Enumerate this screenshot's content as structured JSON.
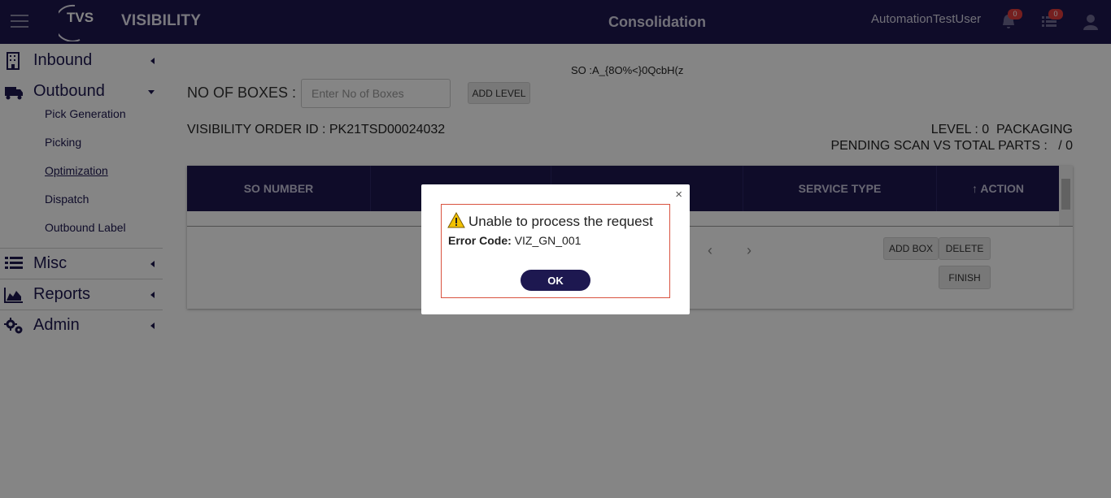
{
  "header": {
    "brand": "VISIBILITY",
    "logo_text": "TVS",
    "logo_subtext": "Supply Chain Solutions",
    "page_title": "Consolidation",
    "username": "AutomationTestUser",
    "notifications_count": "0",
    "tasks_count": "0"
  },
  "sidebar": {
    "inbound": "Inbound",
    "outbound": "Outbound",
    "outbound_items": [
      "Pick Generation",
      "Picking",
      "Optimization",
      "Dispatch",
      "Outbound Label"
    ],
    "misc": "Misc",
    "reports": "Reports",
    "admin": "Admin"
  },
  "main": {
    "so_line": "SO :A_{8O%<}0QcbH(z",
    "boxes_label": "NO OF BOXES :",
    "boxes_placeholder": "Enter No of Boxes",
    "add_level": "ADD LEVEL",
    "order_id": "VISIBILITY ORDER ID : PK21TSD00024032",
    "level": "LEVEL : 0  PACKAGING",
    "pending": "PENDING SCAN VS TOTAL PARTS :   / 0",
    "columns": [
      "SO NUMBER",
      "",
      "",
      "SERVICE TYPE",
      "ACTION"
    ],
    "sort_arrow": "↑",
    "add_box": "ADD BOX",
    "delete": "DELETE",
    "finish": "FINISH",
    "pager_prev": "‹",
    "pager_next": "›"
  },
  "modal": {
    "title": "Unable to process the request",
    "error_label": "Error Code:",
    "error_code": "VIZ_GN_001",
    "ok": "OK",
    "close": "×"
  },
  "colors": {
    "primary": "#1d1850",
    "badge": "#e03d3d",
    "modal_border": "#d9533f",
    "warning": "#f2c200"
  }
}
